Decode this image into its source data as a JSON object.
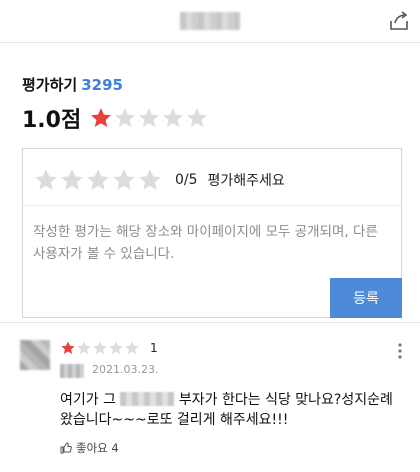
{
  "share_icon": "share-icon",
  "review_section": {
    "heading": "평가하기",
    "review_count": "3295",
    "average_score": "1.0점",
    "average_stars": 1,
    "max_stars": 5
  },
  "review_form": {
    "rating_fraction": "0/5",
    "rating_hint": "평가해주세요",
    "placeholder": "작성한 평가는 해당 장소와 마이페이지에 모두 공개되며, 다른 사용자가 볼 수 있습니다.",
    "submit_label": "등록"
  },
  "review": {
    "rating": "1",
    "star_count": 1,
    "date": "2021.03.23.",
    "text_part1": "여기가 그",
    "text_part2": "부자가 한다는 식당 맞나요?성지순례 왔습니다~~~로또 걸리게 해주세요!!!",
    "like_label": "좋아요",
    "like_count": "4"
  },
  "colors": {
    "accent": "#3d7fd9",
    "star_on": "#e8413b",
    "star_off": "#dcdcdc",
    "button": "#4d8bd9"
  }
}
